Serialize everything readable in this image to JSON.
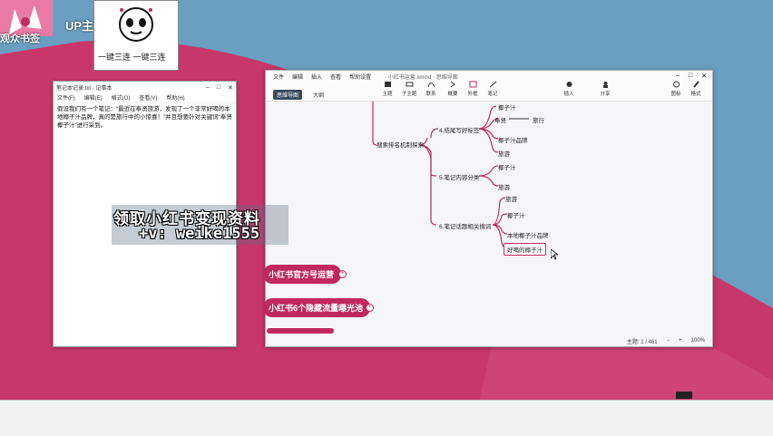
{
  "overlay": {
    "viewer_text": "观众书签",
    "up_text": "UP主",
    "triple_text": "一键三连 一键三连"
  },
  "notepad": {
    "title": "笔记本记录.txt - 记事本",
    "menu": [
      "文件(F)",
      "编辑(E)",
      "格式(O)",
      "查看(V)",
      "帮助(H)"
    ],
    "body": "假设我们有一个笔记：“最近在奉贤旅游，发现了一个非常好喝的本地椰子汁品牌，真的是旅行中的小惊喜！”并且想要针对关键词“奉贤椰子汁”进行采到。"
  },
  "promo": {
    "line1": "领取小红书变现资料",
    "line2": "+v: weike1555"
  },
  "mindmap": {
    "title": "文件  编辑  插入  查看  帮助设置 · 小红书运营.xmind · 思维导图",
    "menu": [
      "文件",
      "编辑",
      "插入",
      "查看",
      "帮助设置"
    ],
    "tabs": [
      "思维导图",
      "大纲"
    ],
    "tools": [
      "主题",
      "子主题",
      "联系",
      "概要",
      "外框",
      "笔记"
    ],
    "right_tools": [
      "插入",
      "分享"
    ],
    "far_tools": [
      "图标",
      "格式"
    ],
    "nodes": {
      "root": "搜索排名机制探索",
      "b1": "4.结尾写好标签",
      "b1_1": "椰子汁",
      "b1_2": "奉贤",
      "b1_2_arrow": "旅行",
      "b1_3": "椰子汁品牌",
      "b1_4": "旅游",
      "b2": "5.笔记内容分类",
      "b2_1": "椰子汁",
      "b2_2": "旅游",
      "b3": "6.笔记话题相关搜词",
      "b3_1": "旅游",
      "b3_2": "椰子汁",
      "b3_3": "本地椰子汁品牌",
      "b3_4": "好喝的椰子汁"
    },
    "status": [
      "主题: 1 / 461",
      "−",
      "+",
      "100%"
    ]
  },
  "pills": {
    "p1": "小红书官方号运营",
    "p2": "小红书6个隐藏流量曝光池"
  },
  "colors": {
    "accent": "#c0285f",
    "desktop_blue": "#6a9fc2",
    "desktop_red": "#c8376a"
  }
}
